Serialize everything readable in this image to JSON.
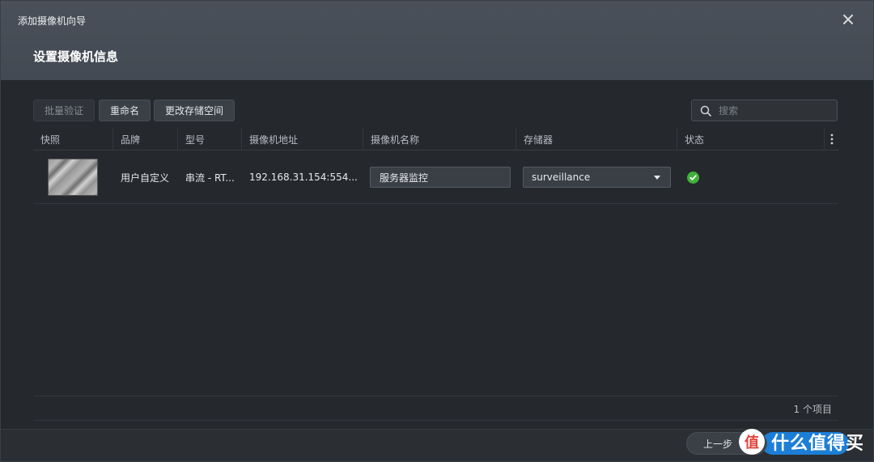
{
  "header": {
    "wizard_title": "添加摄像机向导",
    "step_title": "设置摄像机信息",
    "close_icon": "close-icon"
  },
  "toolbar": {
    "batch_verify_label": "批量验证",
    "rename_label": "重命名",
    "change_storage_label": "更改存储空间",
    "search_placeholder": "搜索",
    "search_icon": "search-icon"
  },
  "grid": {
    "columns": [
      "快照",
      "品牌",
      "型号",
      "摄像机地址",
      "摄像机名称",
      "存储器",
      "状态"
    ],
    "rows": [
      {
        "brand": "用户自定义",
        "model": "串流 - RT...",
        "address": "192.168.31.154:554...",
        "name": "服务器监控",
        "storage": "surveillance",
        "status_icon": "check-circle-icon"
      }
    ],
    "item_count": "1 个项目"
  },
  "footer": {
    "prev_label": "上一步"
  },
  "watermark": {
    "logo_text": "值",
    "text": "什么值得买"
  },
  "colors": {
    "header_bg": "#474d56",
    "body_bg": "#25282c",
    "status_ok": "#3fb23a",
    "primary_button": "#1c7ed6"
  }
}
